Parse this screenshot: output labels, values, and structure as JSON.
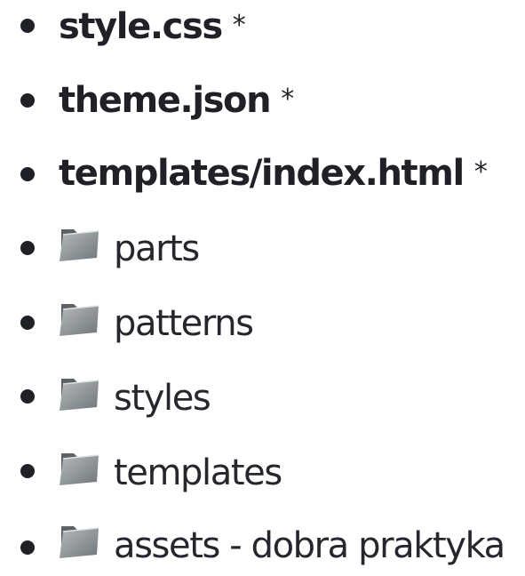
{
  "files": [
    {
      "name": "style.css",
      "marker": "*"
    },
    {
      "name": "theme.json",
      "marker": "*"
    },
    {
      "name": "templates/index.html",
      "marker": "*"
    }
  ],
  "folders": [
    {
      "icon": "folder-icon",
      "name": "parts"
    },
    {
      "icon": "folder-icon",
      "name": "patterns"
    },
    {
      "icon": "folder-icon",
      "name": "styles"
    },
    {
      "icon": "folder-icon",
      "name": "templates"
    },
    {
      "icon": "folder-icon",
      "name": "assets - dobra praktyka"
    }
  ],
  "colors": {
    "text": "#1f2126",
    "folder_dark": "#5e6468",
    "folder_light": "#a9aeb1"
  }
}
